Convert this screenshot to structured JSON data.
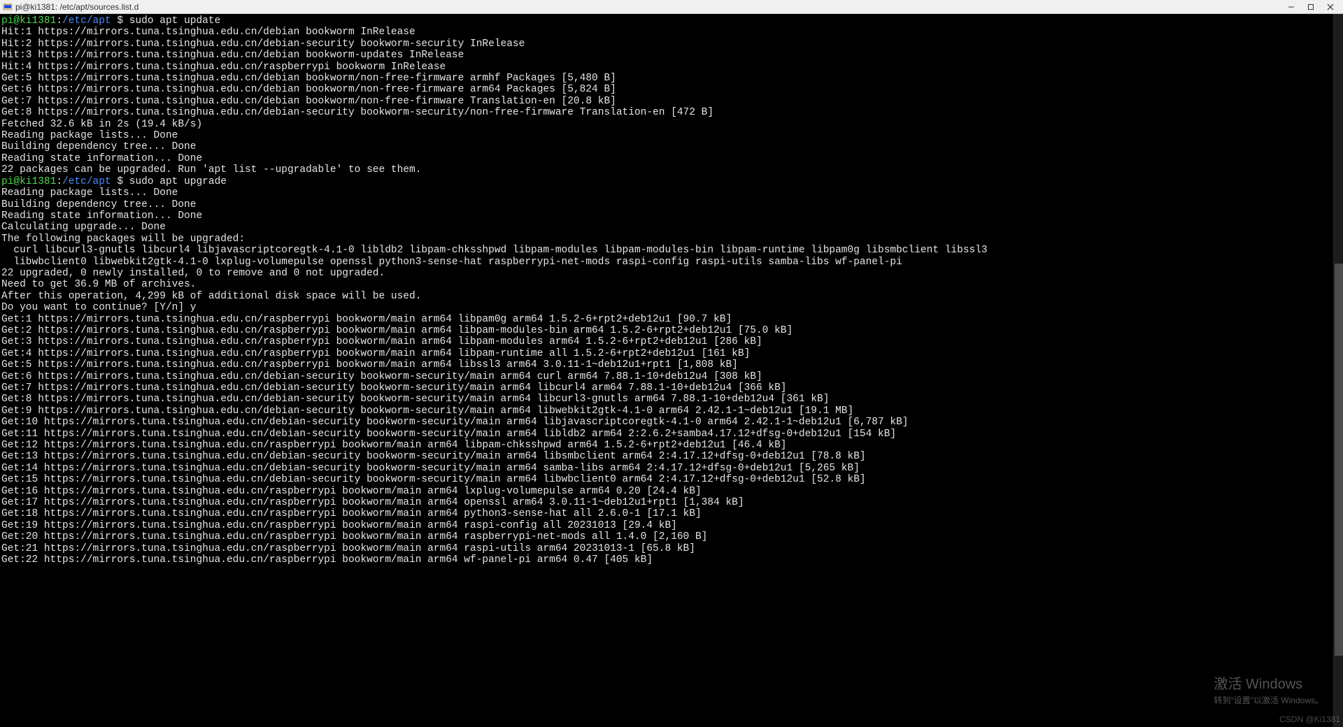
{
  "window": {
    "title": "pi@ki1381: /etc/apt/sources.list.d"
  },
  "prompt": {
    "userhost": "pi@ki1381",
    "path": "/etc/apt",
    "sym_pre": ":",
    "sym_post": " $ "
  },
  "cmd1": "sudo apt update",
  "cmd2": "sudo apt upgrade",
  "block1": [
    "Hit:1 https://mirrors.tuna.tsinghua.edu.cn/debian bookworm InRelease",
    "Hit:2 https://mirrors.tuna.tsinghua.edu.cn/debian-security bookworm-security InRelease",
    "Hit:3 https://mirrors.tuna.tsinghua.edu.cn/debian bookworm-updates InRelease",
    "Hit:4 https://mirrors.tuna.tsinghua.edu.cn/raspberrypi bookworm InRelease",
    "Get:5 https://mirrors.tuna.tsinghua.edu.cn/debian bookworm/non-free-firmware armhf Packages [5,480 B]",
    "Get:6 https://mirrors.tuna.tsinghua.edu.cn/debian bookworm/non-free-firmware arm64 Packages [5,824 B]",
    "Get:7 https://mirrors.tuna.tsinghua.edu.cn/debian bookworm/non-free-firmware Translation-en [20.8 kB]",
    "Get:8 https://mirrors.tuna.tsinghua.edu.cn/debian-security bookworm-security/non-free-firmware Translation-en [472 B]",
    "Fetched 32.6 kB in 2s (19.4 kB/s)",
    "Reading package lists... Done",
    "Building dependency tree... Done",
    "Reading state information... Done",
    "22 packages can be upgraded. Run 'apt list --upgradable' to see them."
  ],
  "block2": [
    "Reading package lists... Done",
    "Building dependency tree... Done",
    "Reading state information... Done",
    "Calculating upgrade... Done",
    "The following packages will be upgraded:",
    "  curl libcurl3-gnutls libcurl4 libjavascriptcoregtk-4.1-0 libldb2 libpam-chksshpwd libpam-modules libpam-modules-bin libpam-runtime libpam0g libsmbclient libssl3",
    "  libwbclient0 libwebkit2gtk-4.1-0 lxplug-volumepulse openssl python3-sense-hat raspberrypi-net-mods raspi-config raspi-utils samba-libs wf-panel-pi",
    "22 upgraded, 0 newly installed, 0 to remove and 0 not upgraded.",
    "Need to get 36.9 MB of archives.",
    "After this operation, 4,299 kB of additional disk space will be used.",
    "Do you want to continue? [Y/n] y",
    "Get:1 https://mirrors.tuna.tsinghua.edu.cn/raspberrypi bookworm/main arm64 libpam0g arm64 1.5.2-6+rpt2+deb12u1 [90.7 kB]",
    "Get:2 https://mirrors.tuna.tsinghua.edu.cn/raspberrypi bookworm/main arm64 libpam-modules-bin arm64 1.5.2-6+rpt2+deb12u1 [75.0 kB]",
    "Get:3 https://mirrors.tuna.tsinghua.edu.cn/raspberrypi bookworm/main arm64 libpam-modules arm64 1.5.2-6+rpt2+deb12u1 [286 kB]",
    "Get:4 https://mirrors.tuna.tsinghua.edu.cn/raspberrypi bookworm/main arm64 libpam-runtime all 1.5.2-6+rpt2+deb12u1 [161 kB]",
    "Get:5 https://mirrors.tuna.tsinghua.edu.cn/raspberrypi bookworm/main arm64 libssl3 arm64 3.0.11-1~deb12u1+rpt1 [1,808 kB]",
    "Get:6 https://mirrors.tuna.tsinghua.edu.cn/debian-security bookworm-security/main arm64 curl arm64 7.88.1-10+deb12u4 [308 kB]",
    "Get:7 https://mirrors.tuna.tsinghua.edu.cn/debian-security bookworm-security/main arm64 libcurl4 arm64 7.88.1-10+deb12u4 [366 kB]",
    "Get:8 https://mirrors.tuna.tsinghua.edu.cn/debian-security bookworm-security/main arm64 libcurl3-gnutls arm64 7.88.1-10+deb12u4 [361 kB]",
    "Get:9 https://mirrors.tuna.tsinghua.edu.cn/debian-security bookworm-security/main arm64 libwebkit2gtk-4.1-0 arm64 2.42.1-1~deb12u1 [19.1 MB]",
    "Get:10 https://mirrors.tuna.tsinghua.edu.cn/debian-security bookworm-security/main arm64 libjavascriptcoregtk-4.1-0 arm64 2.42.1-1~deb12u1 [6,787 kB]",
    "Get:11 https://mirrors.tuna.tsinghua.edu.cn/debian-security bookworm-security/main arm64 libldb2 arm64 2:2.6.2+samba4.17.12+dfsg-0+deb12u1 [154 kB]",
    "Get:12 https://mirrors.tuna.tsinghua.edu.cn/raspberrypi bookworm/main arm64 libpam-chksshpwd arm64 1.5.2-6+rpt2+deb12u1 [46.4 kB]",
    "Get:13 https://mirrors.tuna.tsinghua.edu.cn/debian-security bookworm-security/main arm64 libsmbclient arm64 2:4.17.12+dfsg-0+deb12u1 [78.8 kB]",
    "Get:14 https://mirrors.tuna.tsinghua.edu.cn/debian-security bookworm-security/main arm64 samba-libs arm64 2:4.17.12+dfsg-0+deb12u1 [5,265 kB]",
    "Get:15 https://mirrors.tuna.tsinghua.edu.cn/debian-security bookworm-security/main arm64 libwbclient0 arm64 2:4.17.12+dfsg-0+deb12u1 [52.8 kB]",
    "Get:16 https://mirrors.tuna.tsinghua.edu.cn/raspberrypi bookworm/main arm64 lxplug-volumepulse arm64 0.20 [24.4 kB]",
    "Get:17 https://mirrors.tuna.tsinghua.edu.cn/raspberrypi bookworm/main arm64 openssl arm64 3.0.11-1~deb12u1+rpt1 [1,384 kB]",
    "Get:18 https://mirrors.tuna.tsinghua.edu.cn/raspberrypi bookworm/main arm64 python3-sense-hat all 2.6.0-1 [17.1 kB]",
    "Get:19 https://mirrors.tuna.tsinghua.edu.cn/raspberrypi bookworm/main arm64 raspi-config all 20231013 [29.4 kB]",
    "Get:20 https://mirrors.tuna.tsinghua.edu.cn/raspberrypi bookworm/main arm64 raspberrypi-net-mods all 1.4.0 [2,160 B]",
    "Get:21 https://mirrors.tuna.tsinghua.edu.cn/raspberrypi bookworm/main arm64 raspi-utils arm64 20231013-1 [65.8 kB]",
    "Get:22 https://mirrors.tuna.tsinghua.edu.cn/raspberrypi bookworm/main arm64 wf-panel-pi arm64 0.47 [405 kB]"
  ],
  "watermark": {
    "big": "激活 Windows",
    "small": "转到\"设置\"以激活 Windows。"
  },
  "cornermark": "CSDN @Ki1381"
}
